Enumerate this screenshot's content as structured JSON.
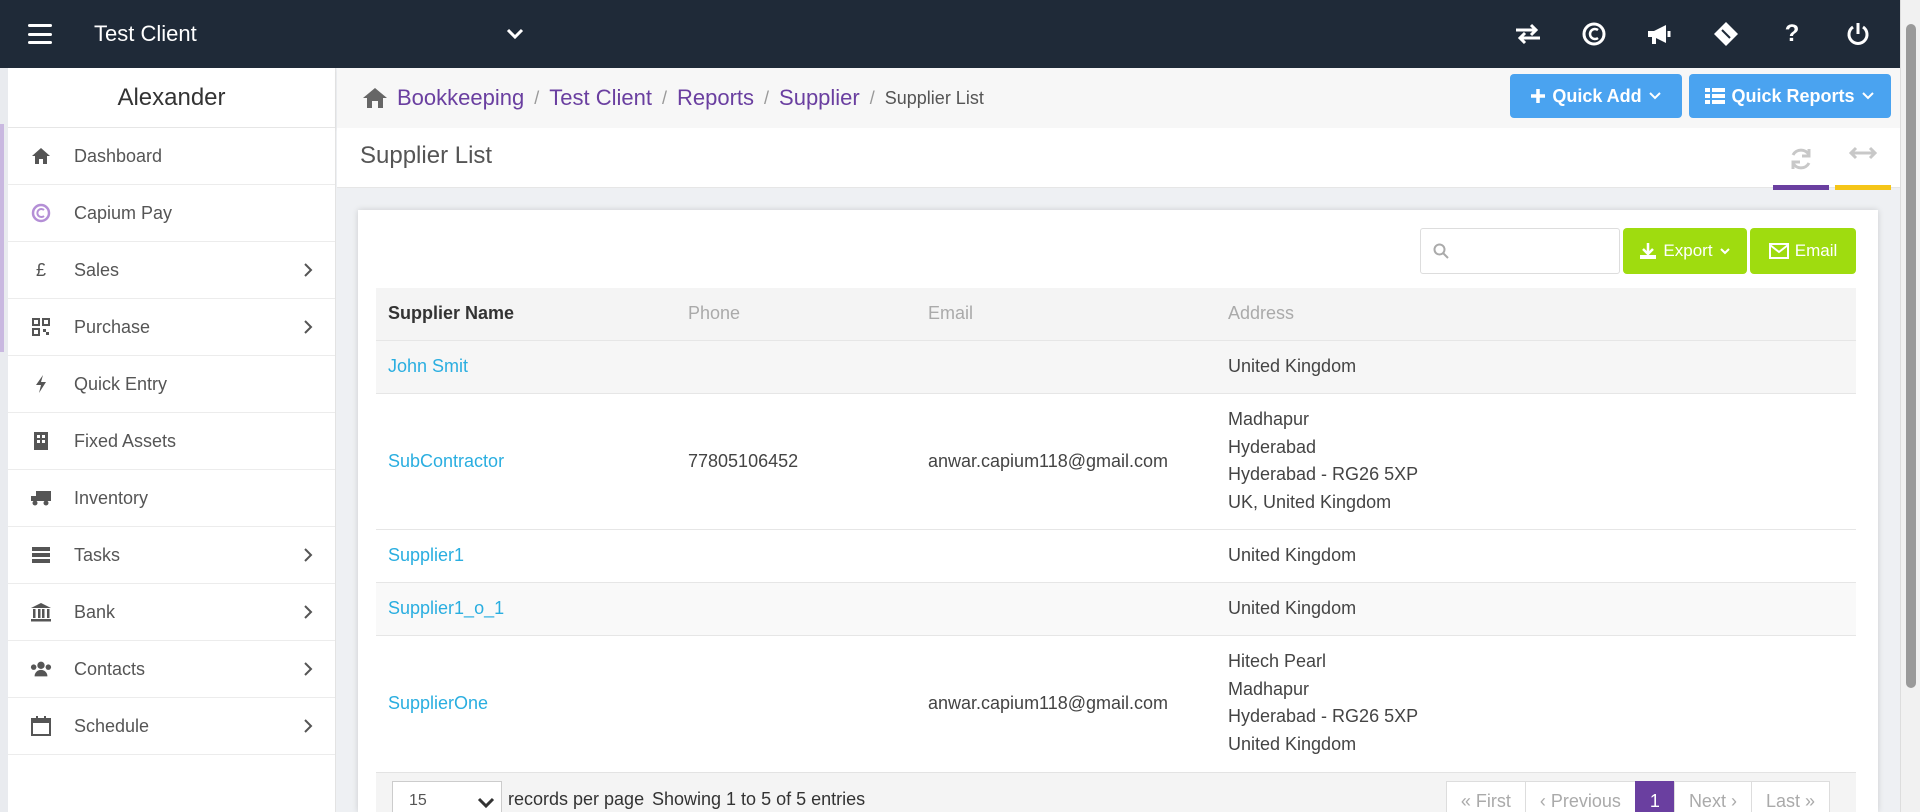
{
  "topbar": {
    "client_name": "Test Client",
    "icons": [
      "transfer-icon",
      "capium-icon",
      "megaphone-icon",
      "ticket-icon",
      "help-icon",
      "power-icon"
    ]
  },
  "sidebar": {
    "user_name": "Alexander",
    "items": [
      {
        "label": "Dashboard",
        "icon": "home-icon",
        "has_submenu": false
      },
      {
        "label": "Capium Pay",
        "icon": "capium-pay-icon",
        "has_submenu": false
      },
      {
        "label": "Sales",
        "icon": "pound-icon",
        "has_submenu": true
      },
      {
        "label": "Purchase",
        "icon": "qr-icon",
        "has_submenu": true
      },
      {
        "label": "Quick Entry",
        "icon": "bolt-icon",
        "has_submenu": false
      },
      {
        "label": "Fixed Assets",
        "icon": "building-icon",
        "has_submenu": false
      },
      {
        "label": "Inventory",
        "icon": "truck-icon",
        "has_submenu": false
      },
      {
        "label": "Tasks",
        "icon": "tasks-icon",
        "has_submenu": true
      },
      {
        "label": "Bank",
        "icon": "bank-icon",
        "has_submenu": true
      },
      {
        "label": "Contacts",
        "icon": "users-icon",
        "has_submenu": true
      },
      {
        "label": "Schedule",
        "icon": "calendar-icon",
        "has_submenu": true
      }
    ]
  },
  "breadcrumb": {
    "items": [
      "Bookkeeping",
      "Test Client",
      "Reports",
      "Supplier"
    ],
    "current": "Supplier List"
  },
  "actions": {
    "quick_add": "Quick Add",
    "quick_reports": "Quick Reports"
  },
  "page": {
    "title": "Supplier List"
  },
  "toolbar": {
    "search_placeholder": "",
    "export": "Export",
    "email": "Email"
  },
  "table": {
    "headers": [
      "Supplier Name",
      "Phone",
      "Email",
      "Address"
    ],
    "rows": [
      {
        "name": "John Smit",
        "phone": "",
        "email": "",
        "address": [
          "United Kingdom"
        ]
      },
      {
        "name": "SubContractor",
        "phone": "77805106452",
        "email": "anwar.capium118@gmail.com",
        "address": [
          "Madhapur",
          "Hyderabad",
          "Hyderabad - RG26 5XP",
          "UK, United Kingdom"
        ]
      },
      {
        "name": "Supplier1",
        "phone": "",
        "email": "",
        "address": [
          "United Kingdom"
        ]
      },
      {
        "name": "Supplier1_o_1",
        "phone": "",
        "email": "",
        "address": [
          "United Kingdom"
        ]
      },
      {
        "name": "SupplierOne",
        "phone": "",
        "email": "anwar.capium118@gmail.com",
        "address": [
          "Hitech Pearl",
          "Madhapur",
          "Hyderabad - RG26 5XP",
          "United Kingdom"
        ]
      }
    ]
  },
  "footer": {
    "per_page": "15",
    "per_page_label": "records per page",
    "showing": "Showing 1 to 5 of 5 entries",
    "first": "« First",
    "previous": "‹ Previous",
    "page": "1",
    "next": "Next ›",
    "last": "Last »"
  },
  "colors": {
    "topbar": "#1f2a38",
    "accent_purple": "#6a3fa0",
    "button_blue": "#4aa3f0",
    "button_green": "#9fdc0f",
    "link": "#2aaee0",
    "header_bar_purple": "#6a3fa0",
    "header_bar_yellow": "#f5c518"
  }
}
